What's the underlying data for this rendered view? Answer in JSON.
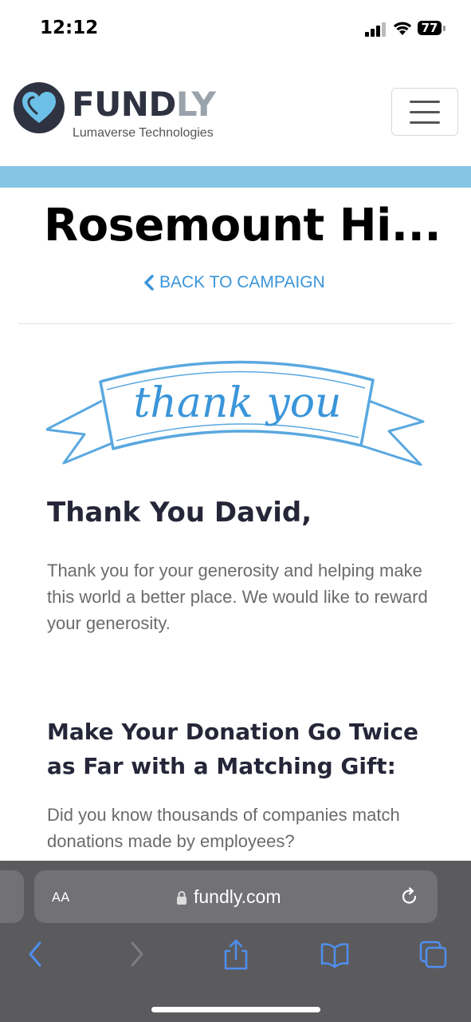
{
  "status": {
    "time": "12:12",
    "battery": "77"
  },
  "header": {
    "logo": {
      "word_main": "FUND",
      "word_accent": "LY",
      "subtitle": "Lumaverse Technologies"
    }
  },
  "colors": {
    "accent_strip": "#86c5e4",
    "link": "#3a95d9",
    "heading": "#252638",
    "body_text": "#6b6b6b"
  },
  "campaign": {
    "title": "Rosemount Hi...",
    "back_link": "BACK TO CAMPAIGN"
  },
  "banner": {
    "text": "thank you"
  },
  "thank_you": {
    "heading": "Thank You David,",
    "body": "Thank you for your generosity and helping make this world a better place. We would like to reward your generosity."
  },
  "matching": {
    "heading": "Make Your Donation Go Twice as Far with a Matching Gift:",
    "body": "Did you know thousands of companies match donations made by employees?"
  },
  "browser": {
    "text_size_label": "AA",
    "url": "fundly.com",
    "toolbar_icons": [
      "back-icon",
      "forward-icon",
      "share-icon",
      "bookmarks-icon",
      "tabs-icon"
    ]
  }
}
